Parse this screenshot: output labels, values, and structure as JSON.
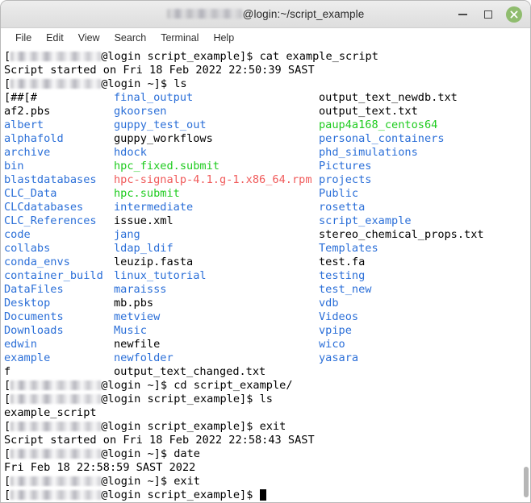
{
  "window": {
    "title_user_redacted": true,
    "title_suffix": "@login:~/script_example",
    "close_icon": "close-icon",
    "minimize_icon": "minimize-icon",
    "maximize_icon": "maximize-icon",
    "accent_close_color": "#8fbc6e"
  },
  "menubar": {
    "items": [
      {
        "label": "File"
      },
      {
        "label": "Edit"
      },
      {
        "label": "View"
      },
      {
        "label": "Search"
      },
      {
        "label": "Terminal"
      },
      {
        "label": "Help"
      }
    ]
  },
  "terminal": {
    "colors": {
      "directory": "#2b6fd8",
      "executable": "#1ecb1e",
      "archive": "#f05a5a",
      "regular_file": "#000000",
      "background": "#ffffff",
      "foreground": "#000000"
    },
    "prompt_suffix_1": "@login script_example]$ ",
    "prompt_suffix_2": "@login ~]$ ",
    "lines": [
      {
        "type": "prompt",
        "prompt": "@login script_example]$ ",
        "command": "cat example_script"
      },
      {
        "type": "output",
        "text": "Script started on Fri 18 Feb 2022 22:50:39 SAST"
      },
      {
        "type": "prompt",
        "prompt": "@login ~]$ ",
        "command": "ls"
      }
    ],
    "ls_columns": {
      "col1": [
        {
          "name": "[##[#",
          "kind": "file"
        },
        {
          "name": "af2.pbs",
          "kind": "file"
        },
        {
          "name": "albert",
          "kind": "dir"
        },
        {
          "name": "alphafold",
          "kind": "dir"
        },
        {
          "name": "archive",
          "kind": "dir"
        },
        {
          "name": "bin",
          "kind": "dir"
        },
        {
          "name": "blastdatabases",
          "kind": "dir"
        },
        {
          "name": "CLC_Data",
          "kind": "dir"
        },
        {
          "name": "CLCdatabases",
          "kind": "dir"
        },
        {
          "name": "CLC_References",
          "kind": "dir"
        },
        {
          "name": "code",
          "kind": "dir"
        },
        {
          "name": "collabs",
          "kind": "dir"
        },
        {
          "name": "conda_envs",
          "kind": "dir"
        },
        {
          "name": "container_build",
          "kind": "dir"
        },
        {
          "name": "DataFiles",
          "kind": "dir"
        },
        {
          "name": "Desktop",
          "kind": "dir"
        },
        {
          "name": "Documents",
          "kind": "dir"
        },
        {
          "name": "Downloads",
          "kind": "dir"
        },
        {
          "name": "edwin",
          "kind": "dir"
        },
        {
          "name": "example",
          "kind": "dir"
        },
        {
          "name": "f",
          "kind": "file"
        }
      ],
      "col2": [
        {
          "name": "final_output",
          "kind": "dir"
        },
        {
          "name": "gkoorsen",
          "kind": "dir"
        },
        {
          "name": "guppy_test_out",
          "kind": "dir"
        },
        {
          "name": "guppy_workflows",
          "kind": "file"
        },
        {
          "name": "hdock",
          "kind": "dir"
        },
        {
          "name": "hpc_fixed.submit",
          "kind": "exe"
        },
        {
          "name": "hpc-signalp-4.1.g-1.x86_64.rpm",
          "kind": "arch"
        },
        {
          "name": "hpc.submit",
          "kind": "exe"
        },
        {
          "name": "intermediate",
          "kind": "dir"
        },
        {
          "name": "issue.xml",
          "kind": "file"
        },
        {
          "name": "jang",
          "kind": "dir"
        },
        {
          "name": "ldap_ldif",
          "kind": "dir"
        },
        {
          "name": "leuzip.fasta",
          "kind": "file"
        },
        {
          "name": "linux_tutorial",
          "kind": "dir"
        },
        {
          "name": "maraisss",
          "kind": "dir"
        },
        {
          "name": "mb.pbs",
          "kind": "file"
        },
        {
          "name": "metview",
          "kind": "dir"
        },
        {
          "name": "Music",
          "kind": "dir"
        },
        {
          "name": "newfile",
          "kind": "file"
        },
        {
          "name": "newfolder",
          "kind": "dir"
        },
        {
          "name": "output_text_changed.txt",
          "kind": "file"
        }
      ],
      "col3": [
        {
          "name": "output_text_newdb.txt",
          "kind": "file"
        },
        {
          "name": "output_text.txt",
          "kind": "file"
        },
        {
          "name": "paup4a168_centos64",
          "kind": "exe"
        },
        {
          "name": "personal_containers",
          "kind": "dir"
        },
        {
          "name": "phd_simulations",
          "kind": "dir"
        },
        {
          "name": "Pictures",
          "kind": "dir"
        },
        {
          "name": "projects",
          "kind": "dir"
        },
        {
          "name": "Public",
          "kind": "dir"
        },
        {
          "name": "rosetta",
          "kind": "dir"
        },
        {
          "name": "script_example",
          "kind": "dir"
        },
        {
          "name": "stereo_chemical_props.txt",
          "kind": "file"
        },
        {
          "name": "Templates",
          "kind": "dir"
        },
        {
          "name": "test.fa",
          "kind": "file"
        },
        {
          "name": "testing",
          "kind": "dir"
        },
        {
          "name": "test_new",
          "kind": "dir"
        },
        {
          "name": "vdb",
          "kind": "dir"
        },
        {
          "name": "Videos",
          "kind": "dir"
        },
        {
          "name": "vpipe",
          "kind": "dir"
        },
        {
          "name": "wico",
          "kind": "dir"
        },
        {
          "name": "yasara",
          "kind": "dir"
        }
      ]
    },
    "tail_lines": [
      {
        "type": "prompt",
        "prompt": "@login ~]$ ",
        "command": "cd script_example/"
      },
      {
        "type": "prompt",
        "prompt": "@login script_example]$ ",
        "command": "ls"
      },
      {
        "type": "output",
        "text": "example_script"
      },
      {
        "type": "prompt",
        "prompt": "@login script_example]$ ",
        "command": "exit"
      },
      {
        "type": "output",
        "text": "Script started on Fri 18 Feb 2022 22:58:43 SAST"
      },
      {
        "type": "prompt",
        "prompt": "@login ~]$ ",
        "command": "date"
      },
      {
        "type": "output",
        "text": "Fri Feb 18 22:58:59 SAST 2022"
      },
      {
        "type": "prompt",
        "prompt": "@login ~]$ ",
        "command": "exit"
      },
      {
        "type": "prompt",
        "prompt": "@login script_example]$ ",
        "command": "",
        "cursor": true
      }
    ]
  }
}
